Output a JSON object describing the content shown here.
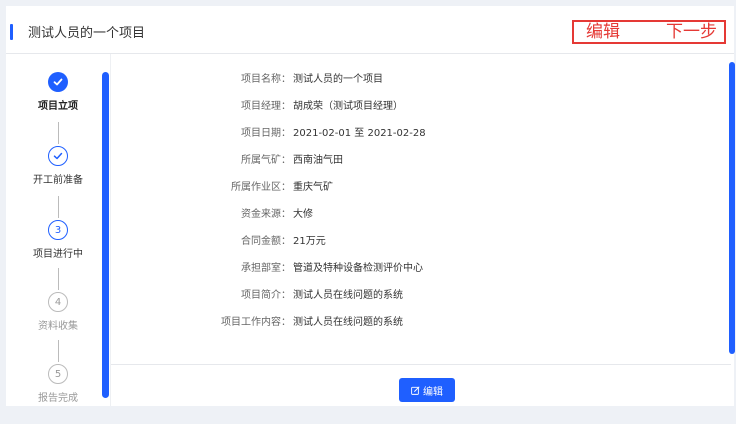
{
  "header": {
    "title": "测试人员的一个项目",
    "edit_label": "编辑",
    "next_label": "下一步"
  },
  "steps": [
    {
      "number": "",
      "label": "项目立项",
      "status": "done"
    },
    {
      "number": "",
      "label": "开工前准备",
      "status": "completed"
    },
    {
      "number": "3",
      "label": "项目进行中",
      "status": "current"
    },
    {
      "number": "4",
      "label": "资料收集",
      "status": "pending"
    },
    {
      "number": "5",
      "label": "报告完成",
      "status": "pending"
    }
  ],
  "details": [
    {
      "key": "项目名称：",
      "value": "测试人员的一个项目"
    },
    {
      "key": "项目经理：",
      "value": "胡成荣（测试项目经理）"
    },
    {
      "key": "项目日期：",
      "value": "2021-02-01 至 2021-02-28"
    },
    {
      "key": "所属气矿：",
      "value": "西南油气田"
    },
    {
      "key": "所属作业区：",
      "value": "重庆气矿"
    },
    {
      "key": "资金来源：",
      "value": "大修"
    },
    {
      "key": "合同金额：",
      "value": "21万元"
    },
    {
      "key": "承担部室：",
      "value": "管道及特种设备检测评价中心"
    },
    {
      "key": "项目简介：",
      "value": "测试人员在线问题的系统"
    },
    {
      "key": "项目工作内容：",
      "value": "测试人员在线问题的系统"
    }
  ],
  "footer": {
    "edit_button_label": "编辑",
    "edit_icon": "edit-icon"
  },
  "colors": {
    "primary": "#1f5fff",
    "highlight_border": "#e53935"
  }
}
